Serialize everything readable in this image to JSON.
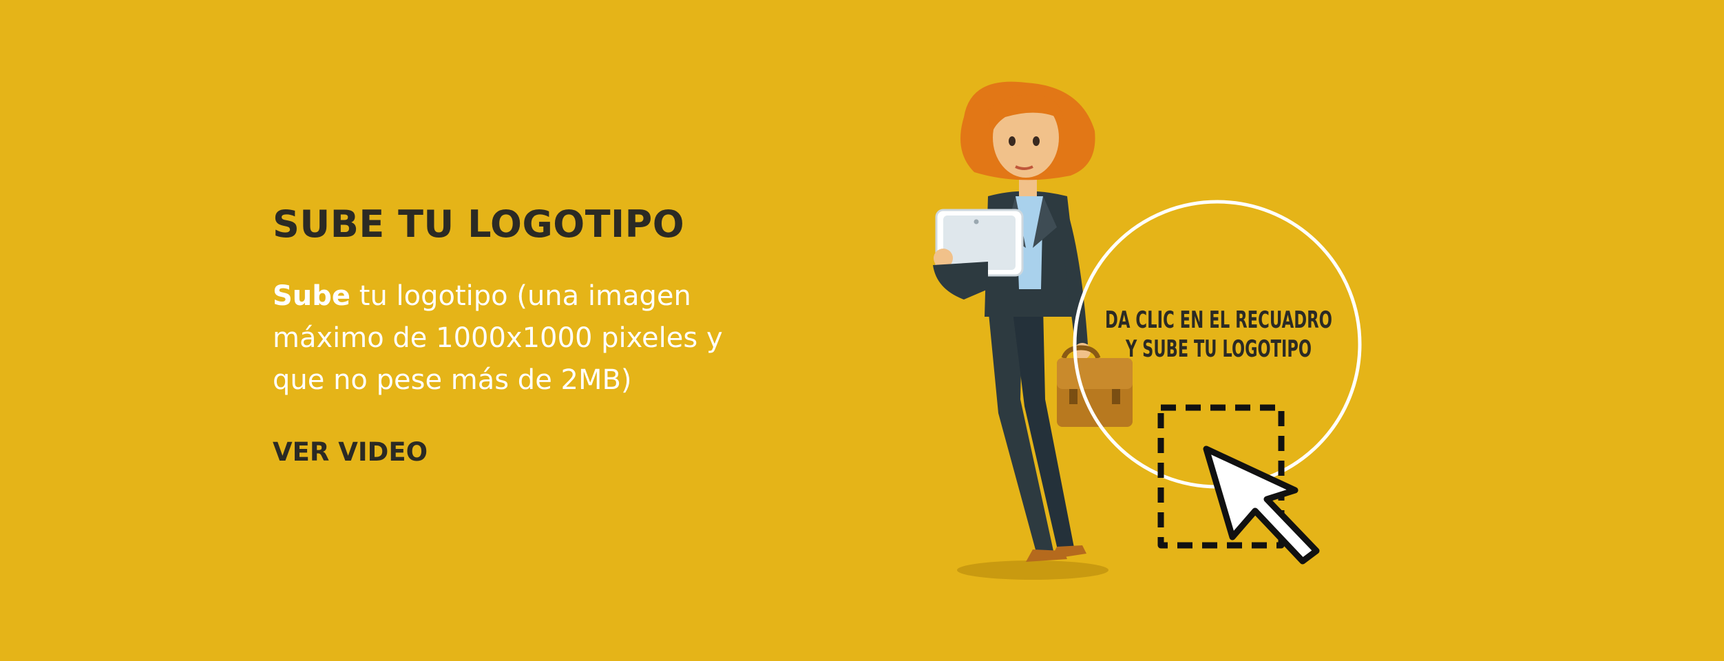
{
  "hero": {
    "title": "SUBE TU LOGOTIPO",
    "description_bold": "Sube",
    "description_rest": " tu logotipo (una imagen máximo de 1000x1000 pixeles y que no pese más de 2MB)",
    "video_link_label": "VER VIDEO"
  },
  "upload_area": {
    "instruction_line1": "DA CLIC EN EL RECUADRO",
    "instruction_line2": "Y SUBE TU LOGOTIPO"
  },
  "colors": {
    "background": "#E5B418",
    "heading": "#2B2A24",
    "body_text": "#FFFFFF"
  },
  "icons": {
    "cursor": "pointer-arrow-icon",
    "dashed_box": "dashed-upload-box-icon"
  }
}
